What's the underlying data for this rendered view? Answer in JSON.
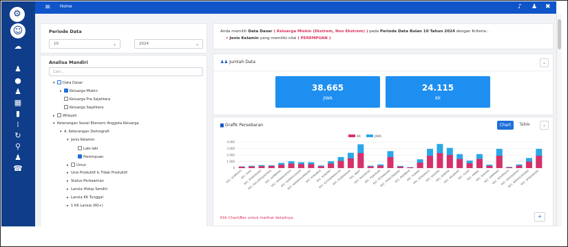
{
  "topbar": {
    "home_label": "Home"
  },
  "filters": {
    "period_label": "Periode Data",
    "month_value": "10",
    "year_value": "2024"
  },
  "analysis": {
    "title": "Analisa Mandiri",
    "search_placeholder": "Cari..."
  },
  "tree": [
    {
      "label": "Data Dasar",
      "indent": 0,
      "arrow": "▾",
      "check": "partial"
    },
    {
      "label": "Keluarga Miskin",
      "indent": 1,
      "arrow": "▸",
      "check": "checked"
    },
    {
      "label": "Keluarga Pra Sejahtera",
      "indent": 1,
      "arrow": "",
      "check": "none"
    },
    {
      "label": "Keluarga Sejahtera",
      "indent": 1,
      "arrow": "",
      "check": "none"
    },
    {
      "label": "Wilayah",
      "indent": 0,
      "arrow": "▸",
      "check": "none"
    },
    {
      "label": "Keterangan Sosial Ekonomi Anggota Keluarga",
      "indent": 0,
      "arrow": "▾",
      "check": "nobox"
    },
    {
      "label": "A. Keterangan Demografi",
      "indent": 1,
      "arrow": "▾",
      "check": "nobox"
    },
    {
      "label": "Jenis Kelamin",
      "indent": 2,
      "arrow": "▾",
      "check": "nobox"
    },
    {
      "label": "Laki-laki",
      "indent": 3,
      "arrow": "",
      "check": "none"
    },
    {
      "label": "Perempuan",
      "indent": 3,
      "arrow": "",
      "check": "checked"
    },
    {
      "label": "Umur",
      "indent": 2,
      "arrow": "▸",
      "check": "none"
    },
    {
      "label": "Usia Produktif & Tidak Produktif",
      "indent": 2,
      "arrow": "▸",
      "check": "nobox"
    },
    {
      "label": "Status Perkawinan",
      "indent": 2,
      "arrow": "▸",
      "check": "nobox"
    },
    {
      "label": "Lansia Hidup Sendiri",
      "indent": 2,
      "arrow": "▸",
      "check": "nobox"
    },
    {
      "label": "Lansia KK Tunggal",
      "indent": 2,
      "arrow": "▸",
      "check": "nobox"
    },
    {
      "label": "1 KK Lansia (60+)",
      "indent": 2,
      "arrow": "▸",
      "check": "nobox"
    }
  ],
  "info": {
    "prefix": "Anda memilih",
    "data_label": "Data Dasar",
    "data_value": "( Keluarga Miskin (Ekstrem, Non Ekstrem) )",
    "period_prefix": "pada",
    "period_label": "Periode Data Bulan 10 Tahun 2024",
    "criteria_suffix": "dengan Kriteria :",
    "criterion_name": "Jenis Kelamin",
    "criterion_text": "yang memiliki nilai",
    "criterion_value": "( PEREMPUAN )"
  },
  "jumlah": {
    "title": "Jumlah Data",
    "stats": [
      {
        "value": "38.665",
        "unit": "JIWA"
      },
      {
        "value": "24.115",
        "unit": "KK"
      }
    ]
  },
  "grafik": {
    "title": "Grafik Persebaran",
    "chart_tab": "Chart",
    "table_tab": "Table",
    "hint": "Klik Chart/Bar untuk melihat detailnya."
  },
  "colors": {
    "kk": "#d6316a",
    "jiwa": "#2aa7e8",
    "accent": "#1e6fd9",
    "sidebar": "#0f3d8a",
    "topbar": "#0f55c9"
  },
  "chart_data": {
    "type": "bar",
    "series": [
      {
        "name": "KK",
        "values": [
          200,
          250,
          300,
          330,
          520,
          700,
          620,
          600,
          280,
          700,
          1100,
          1500,
          2300,
          250,
          380,
          1700,
          220,
          110,
          850,
          1900,
          2300,
          2000,
          1400,
          750,
          1400,
          350,
          1900,
          120,
          380,
          1000,
          1900
        ]
      },
      {
        "name": "JIWA",
        "values": [
          260,
          350,
          460,
          430,
          800,
          1050,
          900,
          900,
          400,
          1050,
          1700,
          2350,
          3650,
          360,
          560,
          2600,
          330,
          150,
          1350,
          2950,
          3700,
          3100,
          2150,
          1150,
          2150,
          520,
          2950,
          190,
          560,
          1550,
          2950
        ]
      }
    ],
    "ylim": [
      0,
      4000
    ],
    "yticks": [
      "4.000",
      "3.000",
      "2.000",
      "1.000",
      "0"
    ],
    "legend": "top-center",
    "grid": true,
    "categories": [
      "KEC. ADIMULYO",
      "KEC. AYAH",
      "KEC. BONOROWO",
      "KEC. BULUSPESANTREN",
      "KEC. GOMBONG",
      "KEC. KARANGANYAR",
      "KEC. KARANGGAYAM",
      "KEC. KARANGSAMBUNG",
      "KEC. KEBUMEN",
      "KEC. KLIRONG",
      "KEC. KUTOWINANGUN",
      "KEC. KUWARASAN",
      "KEC. MIRIT",
      "KEC. PADURESO",
      "KEC. PEJAGOAN",
      "KEC. PETANAHAN",
      "KEC. PONCOWARNO",
      "KEC. PREMBUN",
      "KEC. PURING",
      "KEC. ROWOKELE",
      "KEC. SADANG",
      "KEC. SEMPOR",
      "KEC. SRUWENG",
      "KEC. ALIAN",
      "KEC. AMBAL",
      "KEC. BUAYAN",
      "KEC. SAMPANG",
      "KEC. SIDOMULYO",
      "KEC. SINGOJURUH",
      "KEC. WADASLINTANG",
      "KEC. WONOWOSO"
    ]
  }
}
